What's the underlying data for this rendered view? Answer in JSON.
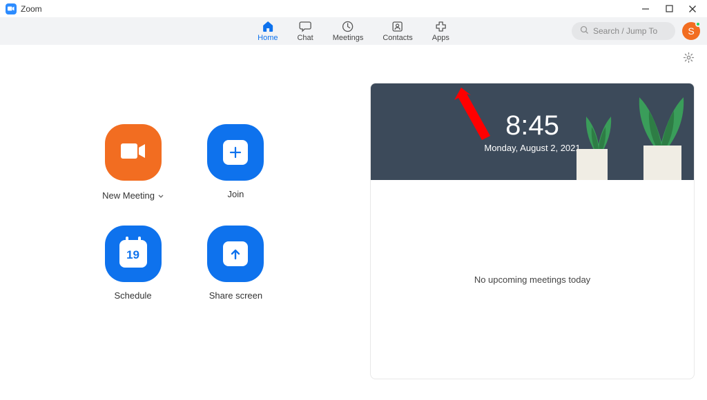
{
  "window": {
    "title": "Zoom"
  },
  "tabs": {
    "home": "Home",
    "chat": "Chat",
    "meetings": "Meetings",
    "contacts": "Contacts",
    "apps": "Apps"
  },
  "search": {
    "placeholder": "Search / Jump To"
  },
  "avatar": {
    "initial": "S"
  },
  "actions": {
    "new_meeting": "New Meeting",
    "join": "Join",
    "schedule": "Schedule",
    "share_screen": "Share screen",
    "schedule_day": "19"
  },
  "calendar": {
    "time": "8:45",
    "date": "Monday, August 2, 2021",
    "empty_message": "No upcoming meetings today"
  }
}
